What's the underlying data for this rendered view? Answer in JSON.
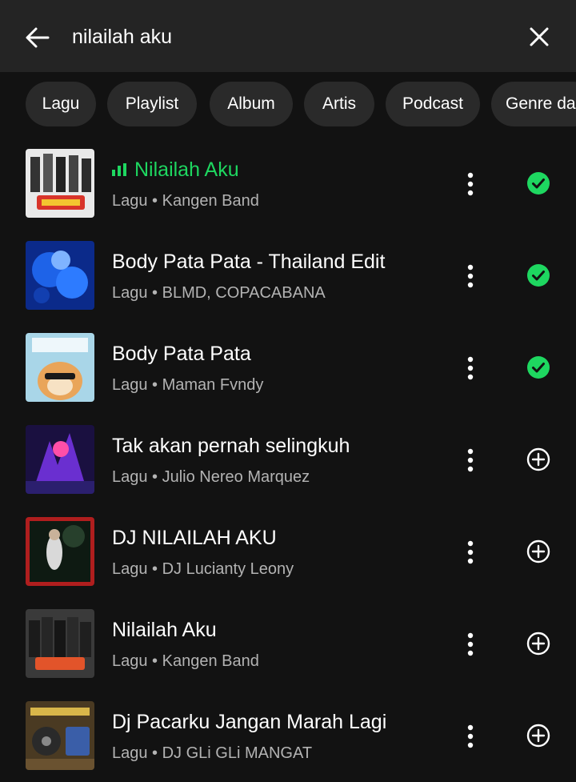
{
  "search": {
    "query": "nilailah aku",
    "back_icon": "arrow-left-icon",
    "clear_icon": "close-icon"
  },
  "filters": [
    "Lagu",
    "Playlist",
    "Album",
    "Artis",
    "Podcast",
    "Genre dan Mood"
  ],
  "colors": {
    "accent": "#1ed760",
    "background": "#121212",
    "header": "#242424",
    "chip": "#2a2a2a",
    "secondary_text": "#b3b3b3"
  },
  "results": [
    {
      "title": "Nilailah Aku",
      "subtitle": "Lagu • Kangen Band",
      "playing": true,
      "added": true,
      "art": "kangen-band-album-art"
    },
    {
      "title": "Body Pata Pata - Thailand Edit",
      "subtitle": "Lagu • BLMD, COPACABANA",
      "playing": false,
      "added": true,
      "art": "blue-abstract-album-art"
    },
    {
      "title": "Body Pata Pata",
      "subtitle": "Lagu • Maman Fvndy",
      "playing": false,
      "added": true,
      "art": "shiba-dog-album-art"
    },
    {
      "title": "Tak akan pernah selingkuh",
      "subtitle": "Lagu • Julio Nereo Marquez",
      "playing": false,
      "added": false,
      "art": "neon-dancer-album-art"
    },
    {
      "title": "DJ NILAILAH AKU",
      "subtitle": "Lagu • DJ Lucianty Leony",
      "playing": false,
      "added": false,
      "art": "dj-night-album-art"
    },
    {
      "title": "Nilailah Aku",
      "subtitle": "Lagu • Kangen Band",
      "playing": false,
      "added": false,
      "art": "kangen-band-group-art"
    },
    {
      "title": "Dj Pacarku Jangan Marah Lagi",
      "subtitle": "Lagu • DJ GLi GLi MANGAT",
      "playing": false,
      "added": false,
      "art": "dj-mixer-album-art"
    }
  ]
}
